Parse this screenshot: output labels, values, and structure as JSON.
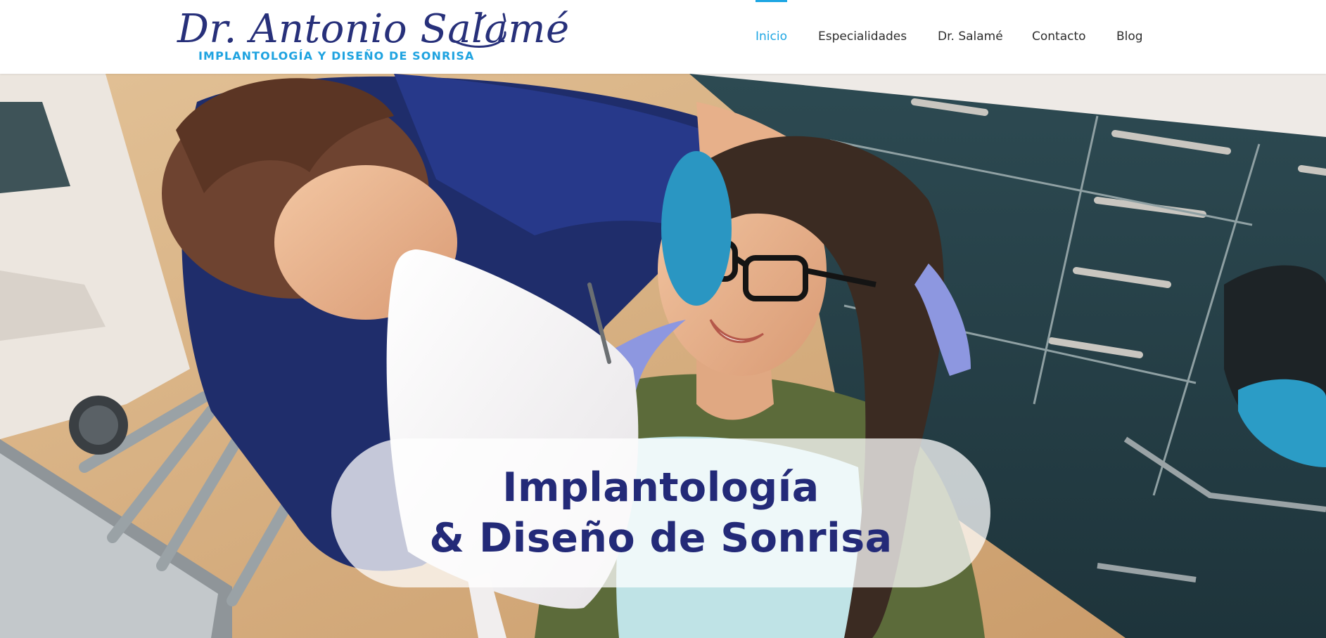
{
  "header": {
    "logo": {
      "name": "Dr. Antonio Salamé",
      "tagline": "IMPLANTOLOGÍA Y DISEÑO DE SONRISA"
    },
    "nav": [
      {
        "label": "Inicio",
        "active": true
      },
      {
        "label": "Especialidades",
        "active": false
      },
      {
        "label": "Dr. Salamé",
        "active": false
      },
      {
        "label": "Contacto",
        "active": false
      },
      {
        "label": "Blog",
        "active": false
      }
    ]
  },
  "hero": {
    "photo": "dentist showing a smiling patient a hand mirror in a dental clinic",
    "title_line1": "Implantología",
    "title_line2": "& Diseño de Sonrisa"
  },
  "colors": {
    "brand_navy": "#232a78",
    "accent_blue": "#1ea6e3",
    "nav_text": "#2d2d2d"
  }
}
